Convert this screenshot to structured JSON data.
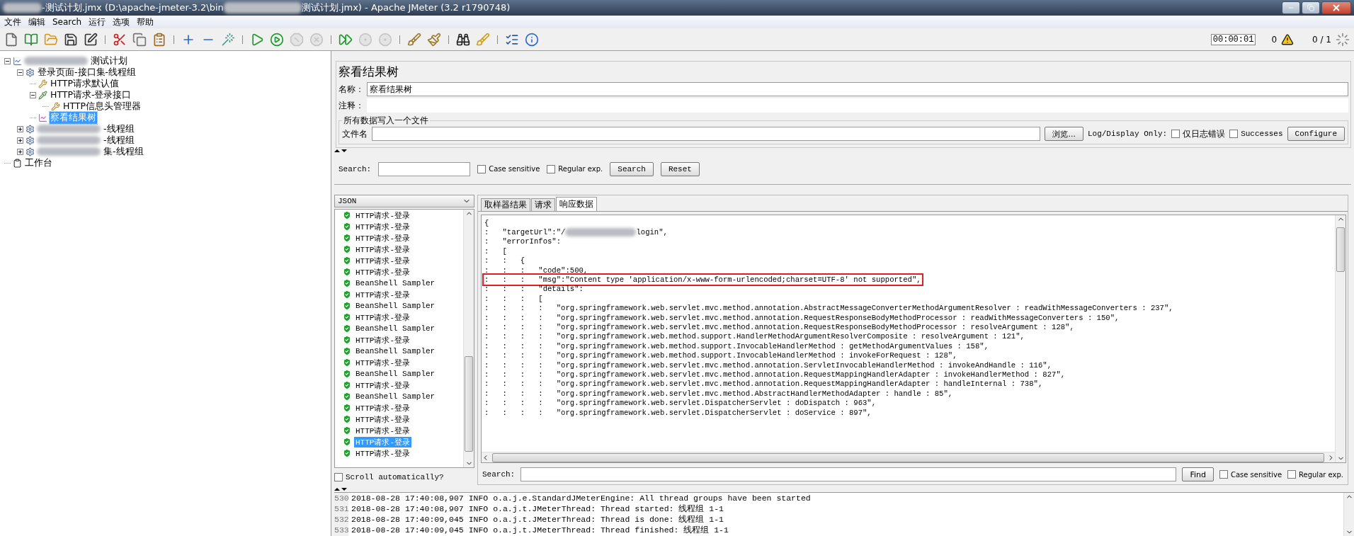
{
  "window": {
    "title_start": "-测试计划.jmx (D:\\apache-jmeter-3.2\\bin",
    "title_end": "测试计划.jmx) - Apache JMeter (3.2 r1790748)"
  },
  "menu": [
    "文件",
    "编辑",
    "Search",
    "运行",
    "选项",
    "帮助"
  ],
  "toolbar": [
    [
      {
        "kind": "new",
        "disabled": false
      },
      {
        "kind": "templates",
        "disabled": false
      },
      {
        "kind": "open",
        "disabled": false
      },
      {
        "kind": "save",
        "disabled": false
      },
      {
        "kind": "saveas",
        "disabled": false
      }
    ],
    [
      {
        "kind": "cut",
        "disabled": false
      },
      {
        "kind": "copy",
        "disabled": false
      },
      {
        "kind": "paste",
        "disabled": false
      }
    ],
    [
      {
        "kind": "expand",
        "disabled": false
      },
      {
        "kind": "collapse",
        "disabled": false
      },
      {
        "kind": "toggle",
        "disabled": false
      }
    ],
    [
      {
        "kind": "start",
        "disabled": false
      },
      {
        "kind": "startnopause",
        "disabled": false
      },
      {
        "kind": "stop",
        "disabled": true
      },
      {
        "kind": "shutdown",
        "disabled": true
      }
    ],
    [
      {
        "kind": "remotestart",
        "disabled": false
      },
      {
        "kind": "remotestop",
        "disabled": true
      },
      {
        "kind": "remoteexit",
        "disabled": true
      }
    ],
    [
      {
        "kind": "clear",
        "disabled": false
      },
      {
        "kind": "clearall",
        "disabled": false
      }
    ],
    [
      {
        "kind": "search",
        "disabled": false
      },
      {
        "kind": "resetsearch",
        "disabled": false
      }
    ],
    [
      {
        "kind": "functions",
        "disabled": false
      },
      {
        "kind": "help",
        "disabled": false
      }
    ]
  ],
  "status": {
    "timer": "00:00:01",
    "warnings": "0",
    "threads": "0 / 1"
  },
  "tree": [
    {
      "label": "测试计划",
      "kind": "plan",
      "redacted": true,
      "expanded": true,
      "selected": false,
      "children": [
        {
          "label": "登录页面-接口集-线程组",
          "kind": "threadgroup",
          "redacted": false,
          "expanded": true,
          "selected": false,
          "children": [
            {
              "label": "HTTP请求默认值",
              "kind": "config",
              "redacted": false,
              "selected": false
            },
            {
              "label": "HTTP请求-登录接口",
              "kind": "sampler",
              "redacted": false,
              "expanded": true,
              "selected": false,
              "children": [
                {
                  "label": "HTTP信息头管理器",
                  "kind": "config",
                  "redacted": false,
                  "selected": false
                }
              ]
            },
            {
              "label": "察看结果树",
              "kind": "listener",
              "redacted": false,
              "selected": true
            }
          ]
        },
        {
          "label": "-线程组",
          "kind": "threadgroup",
          "redacted": true,
          "expanded": false,
          "selected": false
        },
        {
          "label": "-线程组",
          "kind": "threadgroup",
          "redacted": true,
          "expanded": false,
          "selected": false
        },
        {
          "label": "集-线程组",
          "kind": "threadgroup",
          "redacted": true,
          "expanded": false,
          "selected": false
        }
      ]
    },
    {
      "label": "工作台",
      "kind": "workbench",
      "redacted": false,
      "selected": false
    }
  ],
  "panel": {
    "title": "察看结果树",
    "name_label": "名称：",
    "name_value": "察看结果树",
    "comment_label": "注释：",
    "file_group": "所有数据写入一个文件",
    "file_label": "文件名",
    "browse": "浏览...",
    "log_display": "Log/Display Only:",
    "errors_only": {
      "label": "仅日志错误",
      "checked": false
    },
    "successes": {
      "label": "Successes",
      "checked": false
    },
    "configure": "Configure"
  },
  "search": {
    "label": "Search:",
    "case": {
      "label": "Case sensitive",
      "checked": false
    },
    "regex": {
      "label": "Regular exp.",
      "checked": false
    },
    "search_button": "Search",
    "reset_button": "Reset"
  },
  "renderer": "JSON",
  "samples": [
    {
      "label": "HTTP请求-登录",
      "selected": false
    },
    {
      "label": "HTTP请求-登录",
      "selected": false
    },
    {
      "label": "HTTP请求-登录",
      "selected": false
    },
    {
      "label": "HTTP请求-登录",
      "selected": false
    },
    {
      "label": "HTTP请求-登录",
      "selected": false
    },
    {
      "label": "HTTP请求-登录",
      "selected": false
    },
    {
      "label": "BeanShell Sampler",
      "selected": false
    },
    {
      "label": "HTTP请求-登录",
      "selected": false
    },
    {
      "label": "BeanShell Sampler",
      "selected": false
    },
    {
      "label": "HTTP请求-登录",
      "selected": false
    },
    {
      "label": "BeanShell Sampler",
      "selected": false
    },
    {
      "label": "HTTP请求-登录",
      "selected": false
    },
    {
      "label": "BeanShell Sampler",
      "selected": false
    },
    {
      "label": "HTTP请求-登录",
      "selected": false
    },
    {
      "label": "BeanShell Sampler",
      "selected": false
    },
    {
      "label": "HTTP请求-登录",
      "selected": false
    },
    {
      "label": "BeanShell Sampler",
      "selected": false
    },
    {
      "label": "HTTP请求-登录",
      "selected": false
    },
    {
      "label": "HTTP请求-登录",
      "selected": false
    },
    {
      "label": "HTTP请求-登录",
      "selected": false
    },
    {
      "label": "HTTP请求-登录",
      "selected": true
    },
    {
      "label": "HTTP请求-登录",
      "selected": false
    }
  ],
  "scroll_auto": {
    "label": "Scroll automatically?",
    "checked": false
  },
  "tabs": [
    {
      "label": "取样器结果",
      "selected": false
    },
    {
      "label": "请求",
      "selected": false
    },
    {
      "label": "响应数据",
      "selected": true
    }
  ],
  "response": [
    {
      "text": "{",
      "highlighted": false
    },
    {
      "text": ":   \"targetUrl\":\"/",
      "rest": "login\",",
      "highlighted": false
    },
    {
      "text": ":   \"errorInfos\":",
      "highlighted": false
    },
    {
      "text": ":   [",
      "highlighted": false
    },
    {
      "text": ":   :   {",
      "highlighted": false
    },
    {
      "text": ":   :   :   \"code\":500,",
      "highlighted": false
    },
    {
      "text": ":   :   :   \"msg\":\"Content type 'application/x-www-form-urlencoded;charset=UTF-8' not supported\",",
      "highlighted": true
    },
    {
      "text": ":   :   :   \"details\":",
      "highlighted": false
    },
    {
      "text": ":   :   :   [",
      "highlighted": false
    },
    {
      "text": ":   :   :   :   \"org.springframework.web.servlet.mvc.method.annotation.AbstractMessageConverterMethodArgumentResolver : readWithMessageConverters : 237\",",
      "highlighted": false
    },
    {
      "text": ":   :   :   :   \"org.springframework.web.servlet.mvc.method.annotation.RequestResponseBodyMethodProcessor : readWithMessageConverters : 150\",",
      "highlighted": false
    },
    {
      "text": ":   :   :   :   \"org.springframework.web.servlet.mvc.method.annotation.RequestResponseBodyMethodProcessor : resolveArgument : 128\",",
      "highlighted": false
    },
    {
      "text": ":   :   :   :   \"org.springframework.web.method.support.HandlerMethodArgumentResolverComposite : resolveArgument : 121\",",
      "highlighted": false
    },
    {
      "text": ":   :   :   :   \"org.springframework.web.method.support.InvocableHandlerMethod : getMethodArgumentValues : 158\",",
      "highlighted": false
    },
    {
      "text": ":   :   :   :   \"org.springframework.web.method.support.InvocableHandlerMethod : invokeForRequest : 128\",",
      "highlighted": false
    },
    {
      "text": ":   :   :   :   \"org.springframework.web.servlet.mvc.method.annotation.ServletInvocableHandlerMethod : invokeAndHandle : 116\",",
      "highlighted": false
    },
    {
      "text": ":   :   :   :   \"org.springframework.web.servlet.mvc.method.annotation.RequestMappingHandlerAdapter : invokeHandlerMethod : 827\",",
      "highlighted": false
    },
    {
      "text": ":   :   :   :   \"org.springframework.web.servlet.mvc.method.annotation.RequestMappingHandlerAdapter : handleInternal : 738\",",
      "highlighted": false
    },
    {
      "text": ":   :   :   :   \"org.springframework.web.servlet.mvc.method.AbstractHandlerMethodAdapter : handle : 85\",",
      "highlighted": false
    },
    {
      "text": ":   :   :   :   \"org.springframework.web.servlet.DispatcherServlet : doDispatch : 963\",",
      "highlighted": false
    },
    {
      "text": ":   :   :   :   \"org.springframework.web.servlet.DispatcherServlet : doService : 897\",",
      "highlighted": false
    }
  ],
  "find": {
    "label": "Search:",
    "button": "Find",
    "case": {
      "label": "Case sensitive",
      "checked": false
    },
    "regex": {
      "label": "Regular exp.",
      "checked": false
    }
  },
  "log": [
    {
      "number": "530",
      "text": "2018-08-28 17:40:08,907 INFO o.a.j.e.StandardJMeterEngine: All thread groups have been started"
    },
    {
      "number": "531",
      "text": "2018-08-28 17:40:08,907 INFO o.a.j.t.JMeterThread: Thread started: 线程组 1-1"
    },
    {
      "number": "532",
      "text": "2018-08-28 17:40:09,045 INFO o.a.j.t.JMeterThread: Thread is done: 线程组 1-1"
    },
    {
      "number": "533",
      "text": "2018-08-28 17:40:09,045 INFO o.a.j.t.JMeterThread: Thread finished: 线程组 1-1"
    }
  ]
}
